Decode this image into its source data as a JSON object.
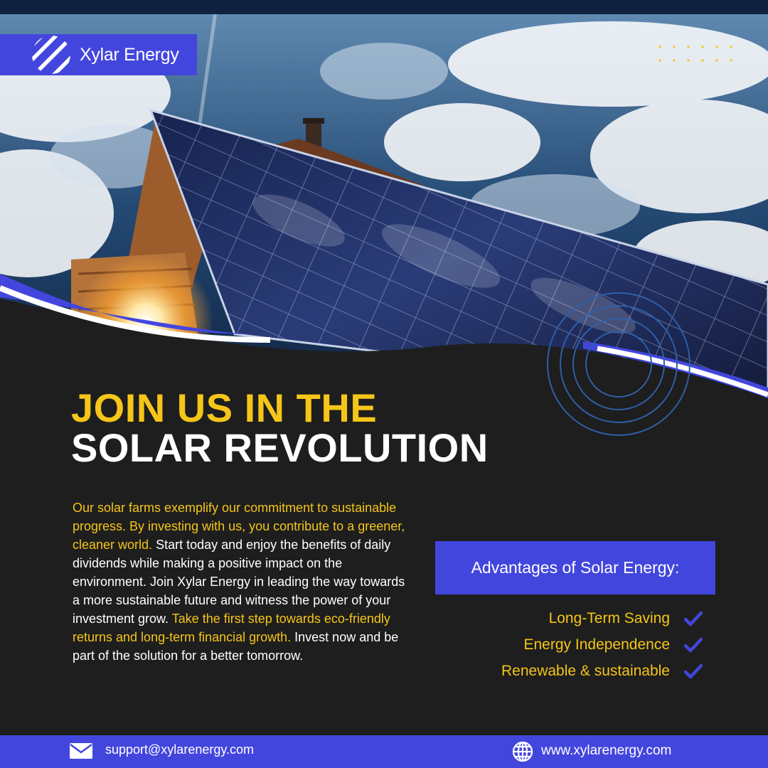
{
  "brand": {
    "name": "Xylar Energy",
    "logo_icon": "striped-circle-logo-icon"
  },
  "headline": {
    "line1": "JOIN US IN THE",
    "line2": "SOLAR REVOLUTION"
  },
  "body": {
    "seg1": "Our solar farms exemplify our commitment to sustainable progress. By investing with us, you contribute to a greener, cleaner world.",
    "seg2": " Start today and enjoy the benefits of daily dividends while making a positive impact on the environment. Join Xylar Energy in leading the way towards a more sustainable future and witness the power of your investment grow.",
    "seg3": " Take the first step towards eco-friendly returns and long-term financial growth.",
    "seg4": " Invest now and be part of the solution for a better tomorrow."
  },
  "advantages": {
    "title": "Advantages of Solar Energy:",
    "items": [
      "Long-Term Saving",
      "Energy Independence",
      "Renewable & sustainable"
    ],
    "item_icon": "checkmark-icon"
  },
  "footer": {
    "email": "support@xylarenergy.com",
    "website": "www.xylarenergy.com",
    "email_icon": "envelope-icon",
    "website_icon": "globe-icon"
  },
  "colors": {
    "accent_blue": "#4346dd",
    "accent_yellow": "#f5c518",
    "background_dark": "#1e1e1e",
    "top_strip": "#0e2240"
  }
}
